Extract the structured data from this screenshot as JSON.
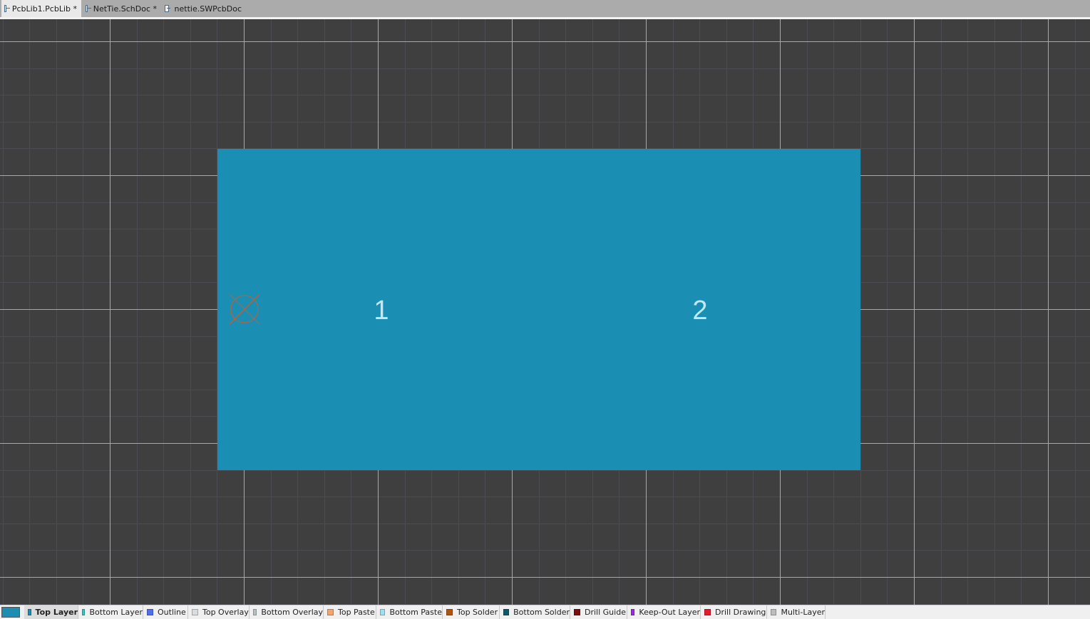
{
  "document_tabs": [
    {
      "label": "PcbLib1.PcbLib *",
      "active": true
    },
    {
      "label": "NetTie.SchDoc *",
      "active": false
    },
    {
      "label": "nettie.SWPcbDoc",
      "active": false
    }
  ],
  "canvas": {
    "background_color": "#3f3f3f",
    "fine_grid_color": "#4b4b52",
    "major_grid_color": "#a8a8a8",
    "component": {
      "fill_color": "#1b8fb3",
      "pads": [
        {
          "designator": "1"
        },
        {
          "designator": "2"
        }
      ],
      "origin_marker": {
        "icon": "origin-crosshair-icon",
        "color": "#d05a2a"
      }
    }
  },
  "layer_bar": {
    "current_layer_color": "#1b8fb3",
    "layers": [
      {
        "label": "Top Layer",
        "color": "#1b8fb3",
        "active": true
      },
      {
        "label": "Bottom Layer",
        "color": "#36c4c4",
        "active": false
      },
      {
        "label": "Outline",
        "color": "#4f6ff0",
        "active": false
      },
      {
        "label": "Top Overlay",
        "color": "#d9dde0",
        "active": false
      },
      {
        "label": "Bottom Overlay",
        "color": "#b8c2c2",
        "active": false
      },
      {
        "label": "Top Paste",
        "color": "#f5a56b",
        "active": false
      },
      {
        "label": "Bottom Paste",
        "color": "#9edff2",
        "active": false
      },
      {
        "label": "Top Solder",
        "color": "#b3540e",
        "active": false
      },
      {
        "label": "Bottom Solder",
        "color": "#0f5a6a",
        "active": false
      },
      {
        "label": "Drill Guide",
        "color": "#7a1010",
        "active": false
      },
      {
        "label": "Keep-Out Layer",
        "color": "#9b2be0",
        "active": false
      },
      {
        "label": "Drill Drawing",
        "color": "#e8182d",
        "active": false
      },
      {
        "label": "Multi-Layer",
        "color": "#bdbdbd",
        "active": false
      }
    ]
  }
}
